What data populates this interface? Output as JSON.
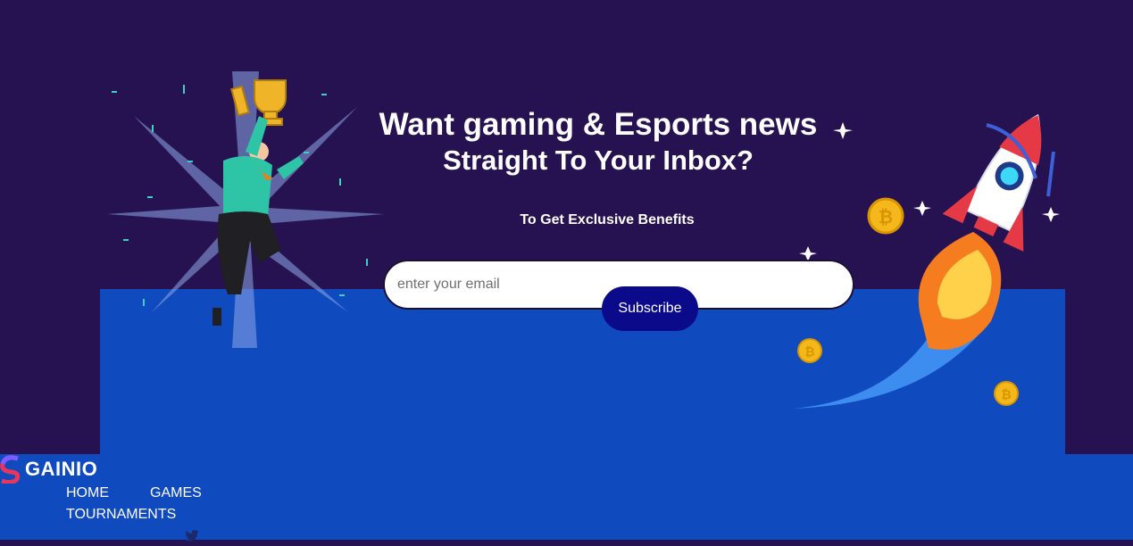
{
  "newsletter": {
    "headline_line1": "Want gaming & Esports news",
    "headline_line2": "Straight To Your Inbox?",
    "subheadline": "To Get Exclusive Benefits",
    "email_placeholder": "enter your email",
    "subscribe_label": "Subscribe"
  },
  "footer": {
    "brand": "GAINIO",
    "nav": [
      "HOME",
      "GAMES",
      "TOURNAMENTS"
    ],
    "social_icons": [
      "twitter-icon"
    ]
  },
  "colors": {
    "background": "#261251",
    "panel_blue": "#0f4abf",
    "button": "#0a0a8a",
    "coin": "#f5b81c",
    "rocket_red": "#e63946"
  }
}
